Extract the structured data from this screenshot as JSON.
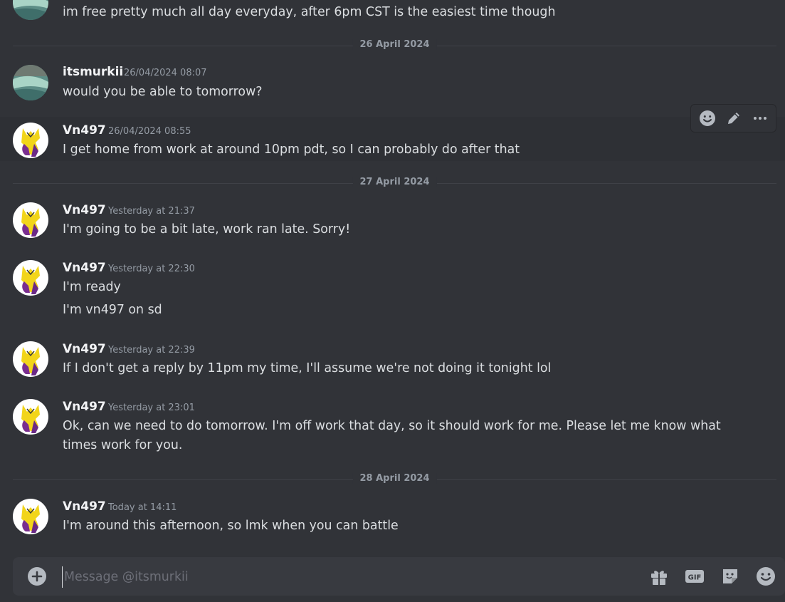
{
  "chat": {
    "top_message": {
      "text": "im free pretty much all day everyday, after 6pm CST is the easiest time though"
    },
    "dividers": [
      "26 April 2024",
      "27 April 2024",
      "28 April 2024"
    ],
    "messages": [
      {
        "username": "itsmurkii",
        "timestamp": "26/04/2024 08:07",
        "lines": [
          "would you be able to tomorrow?"
        ]
      },
      {
        "username": "Vn497",
        "timestamp": "26/04/2024 08:55",
        "lines": [
          "I get home from work at around 10pm pdt, so I can probably do after that"
        ]
      },
      {
        "username": "Vn497",
        "timestamp": "Yesterday at 21:37",
        "lines": [
          "I'm going to be a bit late, work ran late. Sorry!"
        ]
      },
      {
        "username": "Vn497",
        "timestamp": "Yesterday at 22:30",
        "lines": [
          "I'm ready",
          "I'm vn497 on sd"
        ]
      },
      {
        "username": "Vn497",
        "timestamp": "Yesterday at 22:39",
        "lines": [
          "If I don't get a reply by 11pm my time, I'll assume we're not doing it tonight lol"
        ]
      },
      {
        "username": "Vn497",
        "timestamp": "Yesterday at 23:01",
        "lines": [
          "Ok, can we need to do tomorrow. I'm off work that day, so it should work for me. Please let me know what times work for you."
        ]
      },
      {
        "username": "Vn497",
        "timestamp": "Today at 14:11",
        "lines": [
          "I'm around this afternoon, so lmk when you can battle"
        ]
      }
    ]
  },
  "toolbar": {
    "icons": [
      "add-reaction-icon",
      "edit-icon",
      "more-icon"
    ]
  },
  "composer": {
    "placeholder": "Message @itsmurkii",
    "value": "",
    "icons": [
      "plus-icon",
      "gift-icon",
      "gif-icon",
      "sticker-icon",
      "emoji-icon"
    ],
    "gif_label": "GIF"
  },
  "colors": {
    "background": "#313338",
    "composer": "#383a40",
    "text": "#dbdee1",
    "muted": "#949ba4",
    "username": "#f2f3f5"
  }
}
